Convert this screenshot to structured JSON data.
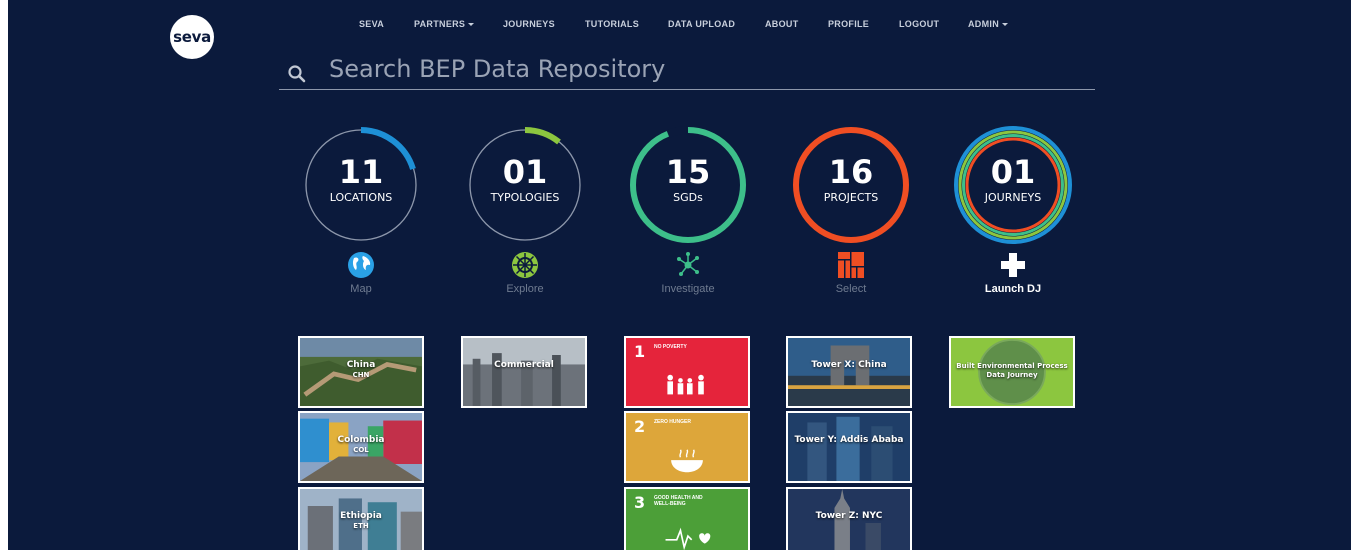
{
  "brand": {
    "logo_text": "seva"
  },
  "nav": {
    "items": [
      {
        "label": "SEVA",
        "dropdown": false
      },
      {
        "label": "PARTNERS",
        "dropdown": true
      },
      {
        "label": "JOURNEYS",
        "dropdown": false
      },
      {
        "label": "TUTORIALS",
        "dropdown": false
      },
      {
        "label": "DATA UPLOAD",
        "dropdown": false
      },
      {
        "label": "ABOUT",
        "dropdown": false
      },
      {
        "label": "PROFILE",
        "dropdown": false
      },
      {
        "label": "LOGOUT",
        "dropdown": false
      },
      {
        "label": "ADMIN",
        "dropdown": true
      }
    ]
  },
  "search": {
    "placeholder": "Search BEP Data Repository",
    "value": ""
  },
  "stats": [
    {
      "number": "11",
      "label": "LOCATIONS",
      "accent": "#1e90d6"
    },
    {
      "number": "01",
      "label": "TYPOLOGIES",
      "accent": "#8cc63f"
    },
    {
      "number": "15",
      "label": "SGDs",
      "accent": "#3dbf8a"
    },
    {
      "number": "16",
      "label": "PROJECTS",
      "accent": "#f04e23"
    },
    {
      "number": "01",
      "label": "JOURNEYS",
      "accent": "#1e90d6"
    }
  ],
  "actions": [
    {
      "label": "Map",
      "icon": "globe-icon"
    },
    {
      "label": "Explore",
      "icon": "compass-wheel-icon"
    },
    {
      "label": "Investigate",
      "icon": "network-icon"
    },
    {
      "label": "Select",
      "icon": "grid-blocks-icon"
    },
    {
      "label": "Launch DJ",
      "icon": "plus-icon"
    }
  ],
  "locations": [
    {
      "name": "China",
      "code": "CHN"
    },
    {
      "name": "Colombia",
      "code": "COL"
    },
    {
      "name": "Ethiopia",
      "code": "ETH"
    }
  ],
  "typologies": [
    {
      "name": "Commercial"
    }
  ],
  "sdgs": [
    {
      "number": "1",
      "name": "NO POVERTY",
      "color": "#e5243b"
    },
    {
      "number": "2",
      "name": "ZERO HUNGER",
      "color": "#dda63a"
    },
    {
      "number": "3",
      "name": "GOOD HEALTH AND WELL-BEING",
      "color": "#4c9f38"
    }
  ],
  "projects": [
    {
      "name": "Tower X: China"
    },
    {
      "name": "Tower  Y: Addis Ababa"
    },
    {
      "name": "Tower Z: NYC"
    }
  ],
  "journeys": [
    {
      "name": "Built Environmental Process Data Journey"
    }
  ]
}
